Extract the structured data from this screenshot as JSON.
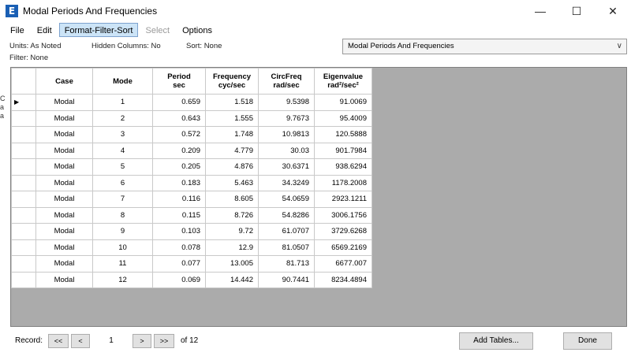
{
  "window": {
    "app_icon_letter": "E",
    "title": "Modal Periods And Frequencies",
    "minimize_glyph": "—",
    "maximize_glyph": "☐",
    "close_glyph": "✕"
  },
  "menu": {
    "file": "File",
    "edit": "Edit",
    "format": "Format-Filter-Sort",
    "select": "Select",
    "options": "Options"
  },
  "info": {
    "units": "Units:  As Noted",
    "hidden_columns": "Hidden Columns:  No",
    "sort": "Sort:  None",
    "filter": "Filter:  None"
  },
  "table_selector": {
    "value": "Modal Periods And Frequencies"
  },
  "left_strip_chars": [
    "C",
    "a",
    "a"
  ],
  "grid": {
    "headers": [
      {
        "line1": "Case",
        "line2": ""
      },
      {
        "line1": "Mode",
        "line2": ""
      },
      {
        "line1": "Period",
        "line2": "sec"
      },
      {
        "line1": "Frequency",
        "line2": "cyc/sec"
      },
      {
        "line1": "CircFreq",
        "line2": "rad/sec"
      },
      {
        "line1": "Eigenvalue",
        "line2": "rad²/sec²"
      }
    ],
    "rows": [
      [
        "Modal",
        "1",
        "0.659",
        "1.518",
        "9.5398",
        "91.0069"
      ],
      [
        "Modal",
        "2",
        "0.643",
        "1.555",
        "9.7673",
        "95.4009"
      ],
      [
        "Modal",
        "3",
        "0.572",
        "1.748",
        "10.9813",
        "120.5888"
      ],
      [
        "Modal",
        "4",
        "0.209",
        "4.779",
        "30.03",
        "901.7984"
      ],
      [
        "Modal",
        "5",
        "0.205",
        "4.876",
        "30.6371",
        "938.6294"
      ],
      [
        "Modal",
        "6",
        "0.183",
        "5.463",
        "34.3249",
        "1178.2008"
      ],
      [
        "Modal",
        "7",
        "0.116",
        "8.605",
        "54.0659",
        "2923.1211"
      ],
      [
        "Modal",
        "8",
        "0.115",
        "8.726",
        "54.8286",
        "3006.1756"
      ],
      [
        "Modal",
        "9",
        "0.103",
        "9.72",
        "61.0707",
        "3729.6268"
      ],
      [
        "Modal",
        "10",
        "0.078",
        "12.9",
        "81.0507",
        "6569.2169"
      ],
      [
        "Modal",
        "11",
        "0.077",
        "13.005",
        "81.713",
        "6677.007"
      ],
      [
        "Modal",
        "12",
        "0.069",
        "14.442",
        "90.7441",
        "8234.4894"
      ]
    ],
    "current_row_index": 0
  },
  "status": {
    "record_label": "Record:",
    "first": "<<",
    "prev": "<",
    "record_value": "1",
    "next": ">",
    "last": ">>",
    "of_text": "of 12",
    "add_tables": "Add Tables...",
    "done": "Done"
  }
}
